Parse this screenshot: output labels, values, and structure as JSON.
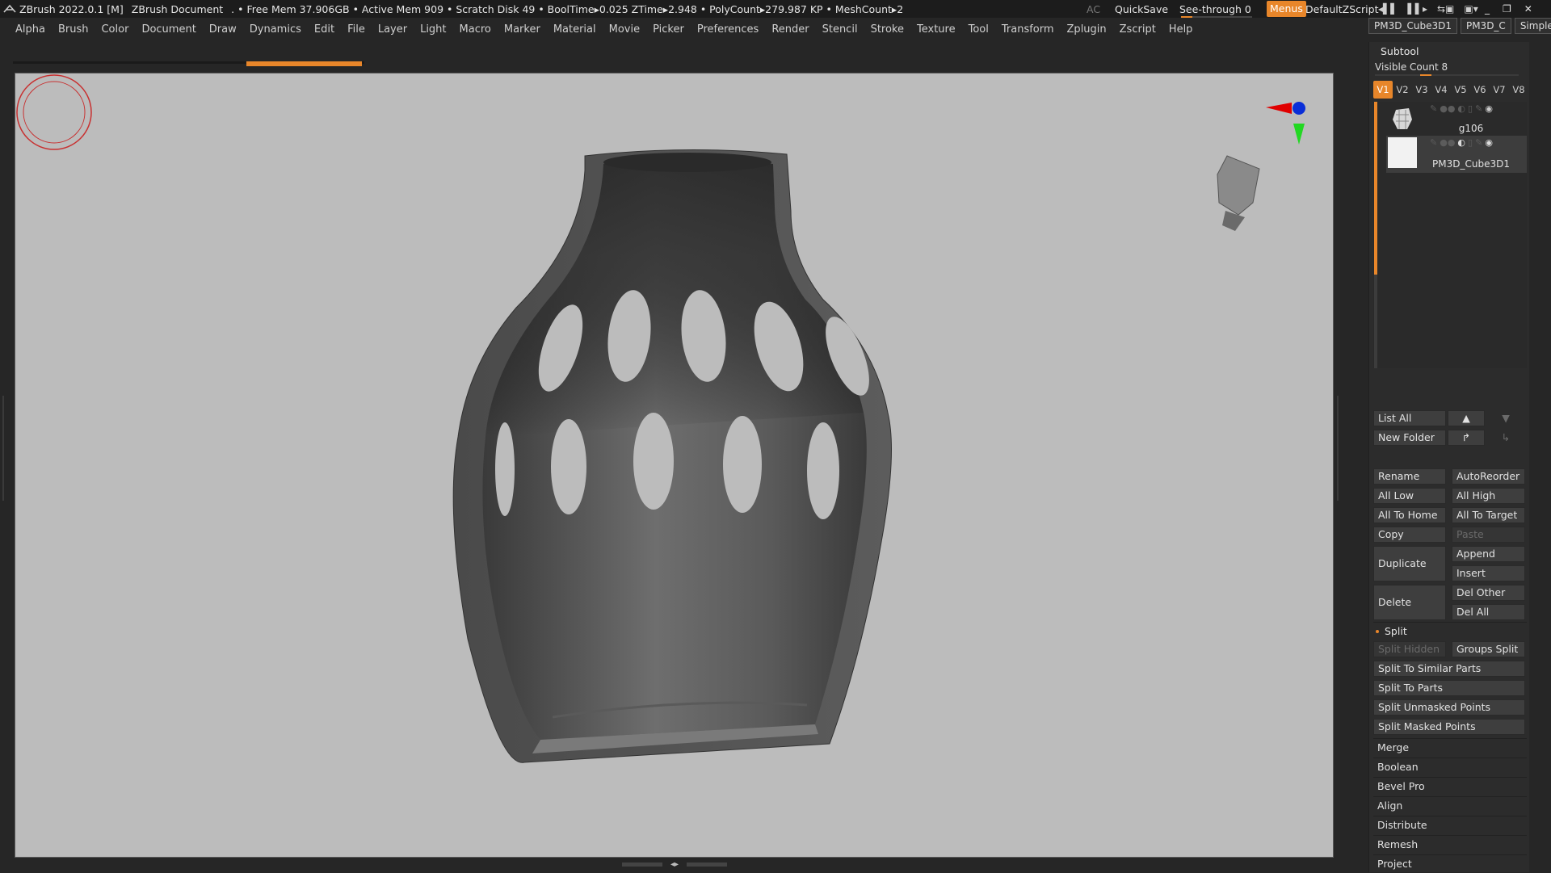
{
  "titlebar": {
    "app": "ZBrush 2022.0.1 [M]",
    "document": "ZBrush Document",
    "stats": ". • Free Mem 37.906GB • Active Mem 909 • Scratch Disk 49 •  BoolTime▸0.025 ZTime▸2.948 • PolyCount▸279.987 KP  • MeshCount▸2",
    "ac": "AC",
    "quicksave": "QuickSave",
    "seethrough": "See-through   0",
    "seethrough_level": 0,
    "menus": "Menus",
    "zscript": "DefaultZScript",
    "accent": "#e8862a"
  },
  "menubar": [
    "Alpha",
    "Brush",
    "Color",
    "Document",
    "Draw",
    "Dynamics",
    "Edit",
    "File",
    "Layer",
    "Light",
    "Macro",
    "Marker",
    "Material",
    "Movie",
    "Picker",
    "Preferences",
    "Render",
    "Stencil",
    "Stroke",
    "Texture",
    "Tool",
    "Transform",
    "Zplugin",
    "Zscript",
    "Help"
  ],
  "tooltabs": [
    "PM3D_Cube3D1",
    "PM3D_C",
    "SimpleB"
  ],
  "subtool": {
    "header": "Subtool",
    "visible_count": "Visible Count 8",
    "versions": [
      "V1",
      "V2",
      "V3",
      "V4",
      "V5",
      "V6",
      "V7",
      "V8"
    ],
    "items": [
      {
        "name": "g106"
      },
      {
        "name": "PM3D_Cube3D1"
      }
    ],
    "buttons": {
      "list_all": "List All",
      "new_folder": "New Folder",
      "rename": "Rename",
      "autoreorder": "AutoReorder",
      "all_low": "All Low",
      "all_high": "All High",
      "all_to_home": "All To Home",
      "all_to_target": "All To Target",
      "copy": "Copy",
      "paste": "Paste",
      "duplicate": "Duplicate",
      "append": "Append",
      "insert": "Insert",
      "delete": "Delete",
      "del_other": "Del Other",
      "del_all": "Del All"
    },
    "split": {
      "label": "Split",
      "split_hidden": "Split Hidden",
      "groups_split": "Groups Split",
      "similar_parts": "Split To Similar Parts",
      "to_parts": "Split To Parts",
      "unmasked": "Split Unmasked Points",
      "masked": "Split Masked Points"
    },
    "sections": [
      "Merge",
      "Boolean",
      "Bevel Pro",
      "Align",
      "Distribute",
      "Remesh",
      "Project"
    ]
  },
  "icons": [
    "zbrush-logo-icon",
    "gizmo-head-icon",
    "brush-cursor-icon",
    "move-up-icon",
    "move-down-icon",
    "folder-arrow-icon",
    "eye-icon"
  ]
}
